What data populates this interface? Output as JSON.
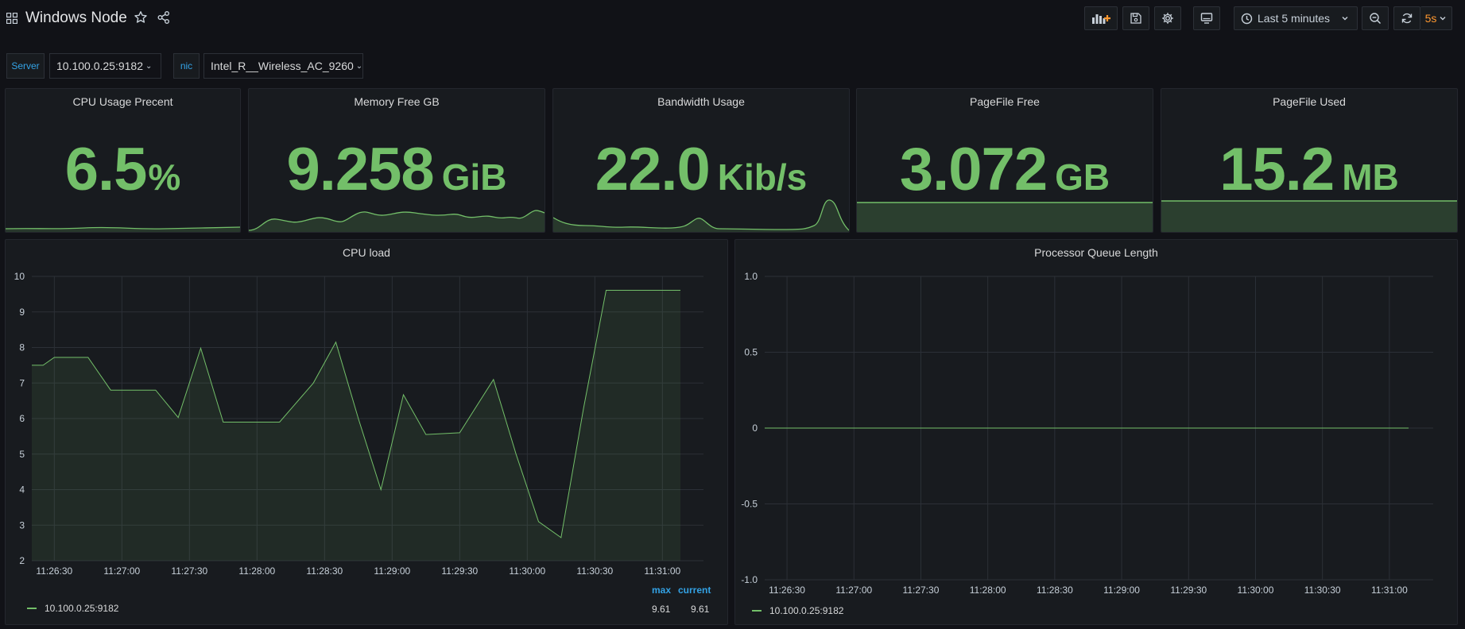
{
  "dashboard": {
    "title": "Windows Node",
    "time_range": "Last 5 minutes",
    "refresh": "5s"
  },
  "variables": [
    {
      "label": "Server",
      "value": "10.100.0.25:9182"
    },
    {
      "label": "nic",
      "value": "Intel_R__Wireless_AC_9260"
    }
  ],
  "stats": [
    {
      "title": "CPU Usage Precent",
      "value": "6.5",
      "unit": "%"
    },
    {
      "title": "Memory Free GB",
      "value": "9.258",
      "unit": "GiB"
    },
    {
      "title": "Bandwidth Usage",
      "value": "22.0",
      "unit": "Kib/s"
    },
    {
      "title": "PageFile Free",
      "value": "3.072",
      "unit": "GB"
    },
    {
      "title": "PageFile Used",
      "value": "15.2",
      "unit": "MB"
    }
  ],
  "colors": {
    "background": "#111217",
    "panel": "#181b1f",
    "series": "#73bf69",
    "accent": "#33a2e5",
    "refresh": "#ff9830"
  },
  "icons": [
    "grid-icon",
    "star-icon",
    "share-icon",
    "add-panel-icon",
    "save-icon",
    "gear-icon",
    "tv-icon",
    "clock-icon",
    "zoom-out-icon",
    "refresh-icon"
  ],
  "chart_data": [
    {
      "type": "line",
      "title": "CPU load",
      "x": [
        "11:26:20",
        "11:26:25",
        "11:26:30",
        "11:26:35",
        "11:26:45",
        "11:26:55",
        "11:27:05",
        "11:27:15",
        "11:27:25",
        "11:27:35",
        "11:27:45",
        "11:28:00",
        "11:28:10",
        "11:28:25",
        "11:28:35",
        "11:28:45",
        "11:28:55",
        "11:29:05",
        "11:29:15",
        "11:29:30",
        "11:29:45",
        "11:29:55",
        "11:30:05",
        "11:30:15",
        "11:30:25",
        "11:30:35",
        "11:30:45",
        "11:31:00",
        "11:31:08"
      ],
      "x_ticks": [
        "11:26:30",
        "11:27:00",
        "11:27:30",
        "11:28:00",
        "11:28:30",
        "11:29:00",
        "11:29:30",
        "11:30:00",
        "11:30:30",
        "11:31:00"
      ],
      "ylim": [
        2,
        10
      ],
      "y_ticks": [
        "2",
        "3",
        "4",
        "5",
        "6",
        "7",
        "8",
        "9",
        "10"
      ],
      "series": [
        {
          "name": "10.100.0.25:9182",
          "values": [
            7.5,
            7.5,
            7.72,
            7.72,
            7.72,
            6.8,
            6.8,
            6.8,
            6.03,
            7.98,
            5.9,
            5.9,
            5.9,
            7.0,
            8.15,
            6.0,
            4.0,
            6.67,
            5.55,
            5.6,
            7.1,
            5.0,
            3.1,
            2.65,
            6.3,
            9.61,
            9.61,
            9.61,
            9.61
          ]
        }
      ],
      "legend": {
        "columns": [
          "max",
          "current"
        ],
        "rows": [
          {
            "name": "10.100.0.25:9182",
            "max": "9.61",
            "current": "9.61"
          }
        ]
      }
    },
    {
      "type": "line",
      "title": "Processor Queue Length",
      "x_ticks": [
        "11:26:30",
        "11:27:00",
        "11:27:30",
        "11:28:00",
        "11:28:30",
        "11:29:00",
        "11:29:30",
        "11:30:00",
        "11:30:30",
        "11:31:00"
      ],
      "ylim": [
        -1.0,
        1.0
      ],
      "y_ticks": [
        "-1.0",
        "-0.5",
        "0",
        "0.5",
        "1.0"
      ],
      "series": [
        {
          "name": "10.100.0.25:9182",
          "values": [
            0,
            0
          ]
        }
      ],
      "legend": {
        "rows": [
          {
            "name": "10.100.0.25:9182"
          }
        ]
      }
    }
  ]
}
